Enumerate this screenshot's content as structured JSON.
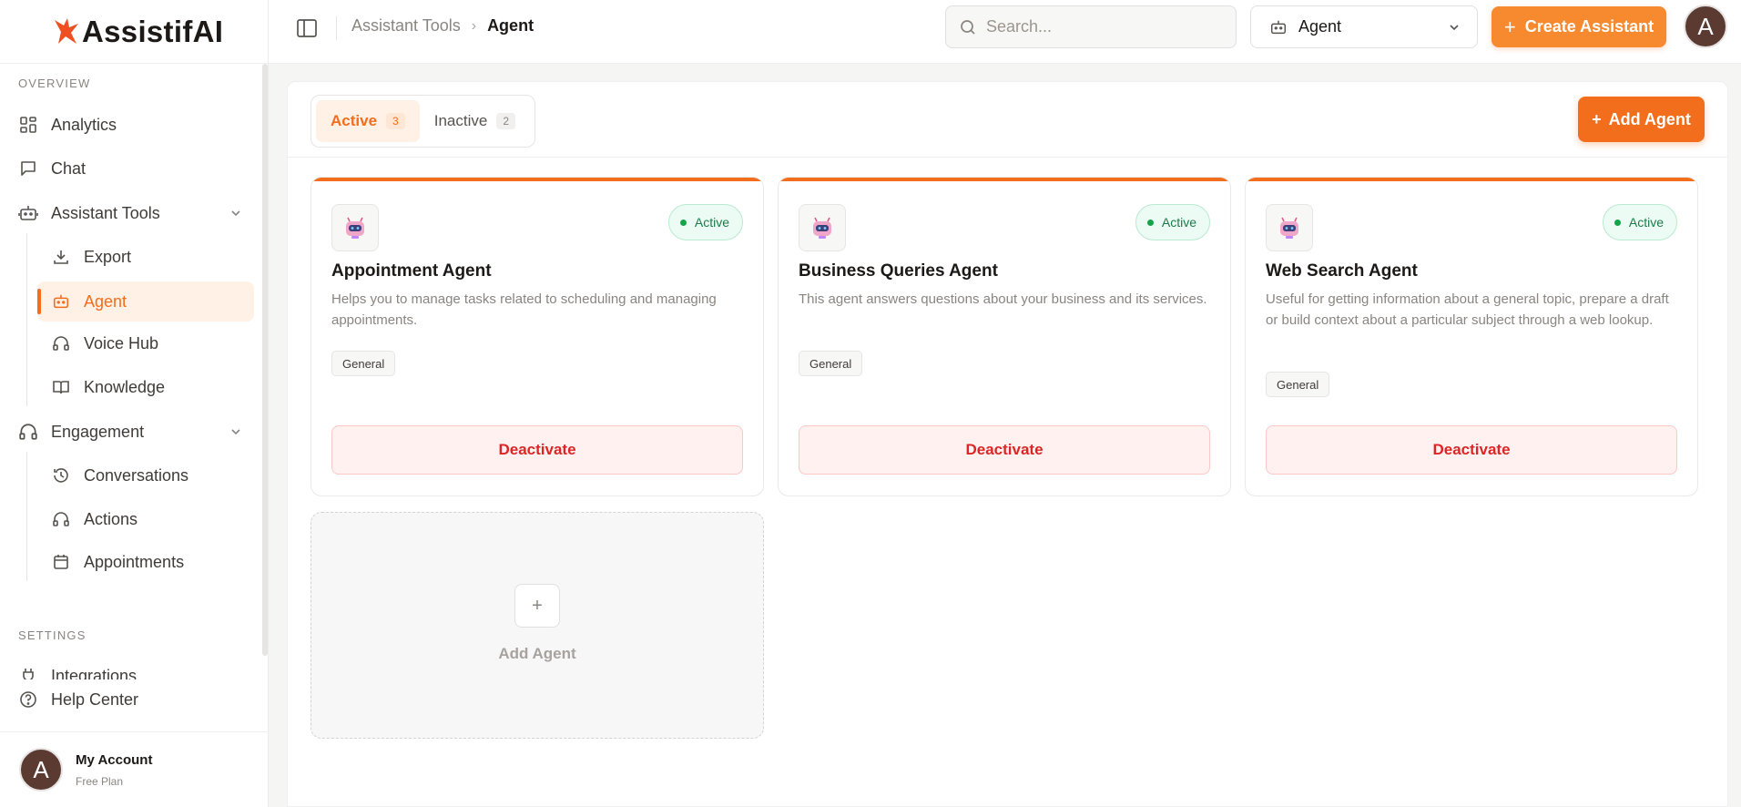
{
  "brand": {
    "name": "AssistifAI",
    "accent": "#f26d1c"
  },
  "sidebar": {
    "overview_label": "OVERVIEW",
    "settings_label": "SETTINGS",
    "items": {
      "analytics": "Analytics",
      "chat": "Chat",
      "assistant_tools": "Assistant Tools",
      "export": "Export",
      "agent": "Agent",
      "voice_hub": "Voice Hub",
      "knowledge": "Knowledge",
      "engagement": "Engagement",
      "conversations": "Conversations",
      "actions": "Actions",
      "appointments": "Appointments",
      "integrations": "Integrations"
    },
    "help_center": "Help Center",
    "account": {
      "initial": "A",
      "name": "My Account",
      "plan": "Free Plan"
    }
  },
  "topbar": {
    "breadcrumb": [
      "Assistant Tools",
      "Agent"
    ],
    "breadcrumb_separator": "›",
    "search_placeholder": "Search...",
    "selected_assistant": "Agent",
    "create_button": "Create Assistant",
    "avatar_initial": "A"
  },
  "tabs": [
    {
      "label": "Active",
      "count": "3"
    },
    {
      "label": "Inactive",
      "count": "2"
    }
  ],
  "add_agent_button": "Add Agent",
  "agents": [
    {
      "title": "Appointment Agent",
      "description": "Helps you to manage tasks related to scheduling and managing appointments.",
      "status": "Active",
      "tag": "General",
      "action": "Deactivate"
    },
    {
      "title": "Business Queries Agent",
      "description": "This agent answers questions about your business and its services.",
      "status": "Active",
      "tag": "General",
      "action": "Deactivate"
    },
    {
      "title": "Web Search Agent",
      "description": "Useful for getting information about a general topic, prepare a draft or build context about a particular subject through a web lookup.",
      "status": "Active",
      "tag": "General",
      "action": "Deactivate"
    }
  ],
  "add_card": {
    "plus": "+",
    "label": "Add Agent"
  }
}
